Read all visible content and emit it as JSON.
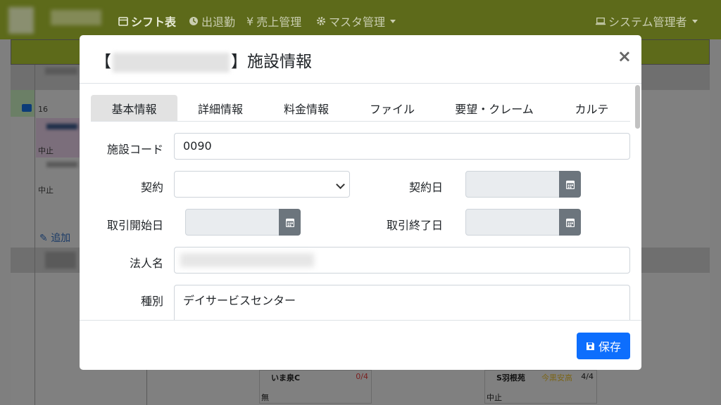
{
  "nav": {
    "items": [
      {
        "label": "シフト表",
        "icon": "calendar-icon"
      },
      {
        "label": "出退勤",
        "icon": "clock-icon"
      },
      {
        "label": "売上管理",
        "icon": "yen-icon"
      },
      {
        "label": "マスタ管理",
        "icon": "gear-icon"
      }
    ],
    "user": "システム管理者"
  },
  "background": {
    "row1_count": "16",
    "status_cancel_1": "中止",
    "status_cancel_2": "中止",
    "add_label": "追加",
    "cards": [
      {
        "title": "いま泉C",
        "count": "0/4",
        "status": "無"
      },
      {
        "title": "S羽根苑",
        "count": "4/4",
        "status": "中止",
        "note": "今黒安高"
      }
    ]
  },
  "modal": {
    "title_prefix": "【",
    "title_suffix": "】施設情報",
    "close": "×",
    "tabs": [
      "基本情報",
      "詳細情報",
      "料金情報",
      "ファイル",
      "要望・クレーム",
      "カルテ"
    ],
    "active_tab": "基本情報",
    "fields": {
      "facility_code_label": "施設コード",
      "facility_code_value": "0090",
      "contract_label": "契約",
      "contract_value": "",
      "contract_date_label": "契約日",
      "start_date_label": "取引開始日",
      "end_date_label": "取引終了日",
      "corp_label": "法人名",
      "type_label": "種別",
      "type_value": "デイサービスセンター"
    },
    "save_label": "保存"
  },
  "colors": {
    "navbar": "#5d6a1a",
    "primary": "#0d6efd",
    "calendar_button": "#6c757d",
    "warning": "#dc3545"
  }
}
